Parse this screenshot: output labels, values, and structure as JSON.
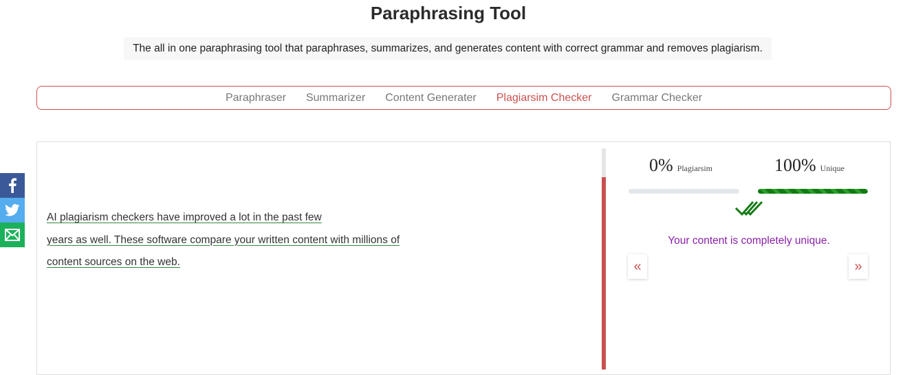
{
  "header": {
    "title": "Paraphrasing Tool",
    "subtitle": "The all in one paraphrasing tool that paraphrases, summarizes, and generates content with correct grammar and removes plagiarism."
  },
  "tabs": [
    {
      "label": "Paraphraser",
      "active": false
    },
    {
      "label": "Summarizer",
      "active": false
    },
    {
      "label": "Content Generater",
      "active": false
    },
    {
      "label": "Plagiarsim Checker",
      "active": true
    },
    {
      "label": "Grammar Checker",
      "active": false
    }
  ],
  "editor": {
    "lines": [
      "AI plagiarism checkers have improved a lot in the past few",
      "years as well. These software compare your written content with millions of",
      "content sources on the web."
    ]
  },
  "scroll_track": {
    "fill_fraction": 0.87
  },
  "results": {
    "plagiarism": {
      "value": "0%",
      "label": "Plagiarsim",
      "fraction": 0
    },
    "unique": {
      "value": "100%",
      "label": "Unique",
      "fraction": 1
    },
    "message": "Your content is completely unique.",
    "prev_glyph": "«",
    "next_glyph": "»"
  },
  "social": [
    {
      "icon": "facebook-icon",
      "color": "#3b5998"
    },
    {
      "icon": "twitter-icon",
      "color": "#55acee"
    },
    {
      "icon": "email-icon",
      "color": "#1bb15b"
    }
  ],
  "colors": {
    "accent": "#c9504f",
    "success": "#127a12",
    "result_text": "#8a1fa8"
  }
}
